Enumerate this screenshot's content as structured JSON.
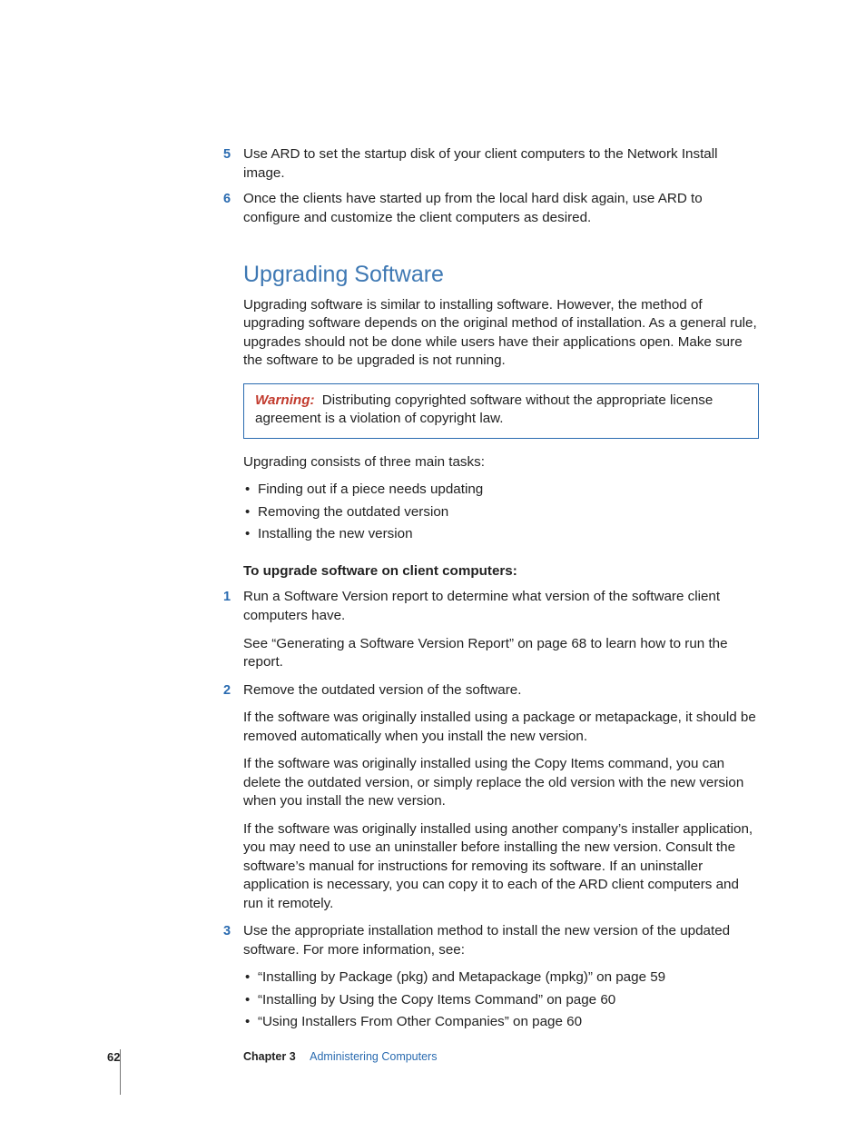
{
  "prelist": [
    {
      "n": "5",
      "text": "Use ARD to set the startup disk of your client computers to the Network Install image."
    },
    {
      "n": "6",
      "text": "Once the clients have started up from the local hard disk again, use ARD to configure and customize the client computers as desired."
    }
  ],
  "heading": "Upgrading Software",
  "intro": "Upgrading software is similar to installing software. However, the method of upgrading software depends on the original method of installation. As a general rule, upgrades should not be done while users have their applications open. Make sure the software to be upgraded is not running.",
  "warning": {
    "label": "Warning:",
    "text": "Distributing copyrighted software without the appropriate license agreement is a violation of copyright law."
  },
  "tasks_lead": "Upgrading consists of three main tasks:",
  "tasks": [
    "Finding out if a piece needs updating",
    "Removing the outdated version",
    "Installing the new version"
  ],
  "procedure_lead": "To upgrade software on client computers:",
  "steps": [
    {
      "n": "1",
      "text": "Run a Software Version report to determine what version of the software client computers have.",
      "sub": [
        "See “Generating a Software Version Report” on page 68 to learn how to run the report."
      ]
    },
    {
      "n": "2",
      "text": "Remove the outdated version of the software.",
      "sub": [
        "If the software was originally installed using a package or metapackage, it should be removed automatically when you install the new version.",
        "If the software was originally installed using the Copy Items command, you can delete the outdated version, or simply replace the old version with the new version when you install the new version.",
        "If the software was originally installed using another company’s installer application, you may need to use an uninstaller before installing the new version. Consult the software’s manual for instructions for removing its software. If an uninstaller application is necessary, you can copy it to each of the ARD client computers and run it remotely."
      ]
    },
    {
      "n": "3",
      "text": "Use the appropriate installation method to install the new version of the updated software. For more information, see:",
      "bullets": [
        "“Installing by Package (pkg) and Metapackage (mpkg)” on page 59",
        "“Installing by Using the Copy Items Command” on page 60",
        "“Using Installers From Other Companies” on page 60"
      ]
    }
  ],
  "footer": {
    "page": "62",
    "chapter_label": "Chapter 3",
    "chapter_title": "Administering Computers"
  }
}
